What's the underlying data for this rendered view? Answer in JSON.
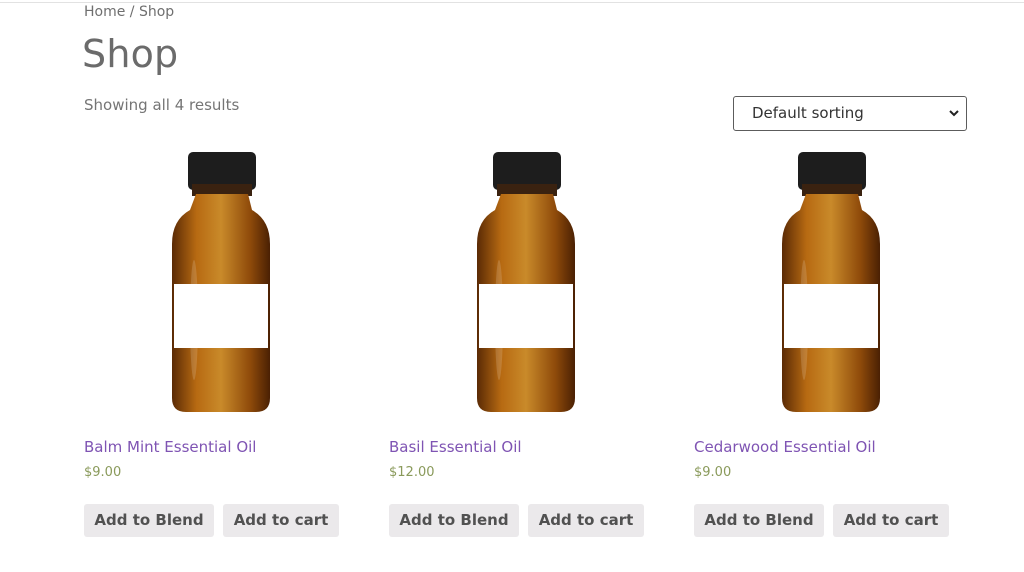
{
  "breadcrumb": {
    "home": "Home",
    "separator": " / ",
    "current": "Shop"
  },
  "page_title": "Shop",
  "result_count": "Showing all 4 results",
  "sorting": {
    "selected": "Default sorting"
  },
  "products": [
    {
      "name": "Balm Mint Essential Oil",
      "price": "$9.00",
      "blend_label": "Add to Blend",
      "cart_label": "Add to cart"
    },
    {
      "name": "Basil Essential Oil",
      "price": "$12.00",
      "blend_label": "Add to Blend",
      "cart_label": "Add to cart"
    },
    {
      "name": "Cedarwood Essential Oil",
      "price": "$9.00",
      "blend_label": "Add to Blend",
      "cart_label": "Add to cart"
    }
  ],
  "colors": {
    "product_link": "#7f54b3",
    "price": "#8a9a5b",
    "button_bg": "#ebe9eb"
  },
  "icons": {
    "sort": "chevron-down-icon"
  }
}
